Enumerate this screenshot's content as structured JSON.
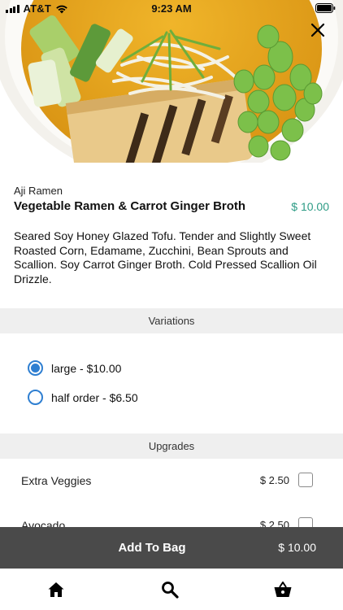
{
  "status_bar": {
    "carrier": "AT&T",
    "time": "9:23 AM",
    "icons": [
      "signal-icon",
      "wifi-icon",
      "battery-icon"
    ]
  },
  "hero": {
    "image": "ramen-bowl-photo",
    "close_icon": "close-icon"
  },
  "item": {
    "restaurant": "Aji Ramen",
    "name": "Vegetable Ramen & Carrot Ginger Broth",
    "price": "$ 10.00",
    "description": "Seared Soy Honey Glazed Tofu. Tender and Slightly Sweet Roasted Corn, Edamame, Zucchini, Bean Sprouts and Scallion. Soy Carrot Ginger Broth.  Cold Pressed Scallion Oil Drizzle."
  },
  "variations": {
    "title": "Variations",
    "options": [
      {
        "label": "large - $10.00",
        "selected": true
      },
      {
        "label": "half order - $6.50",
        "selected": false
      }
    ]
  },
  "upgrades": {
    "title": "Upgrades",
    "items": [
      {
        "name": "Extra Veggies",
        "price": "$ 2.50",
        "checked": false
      },
      {
        "name": "Avocado",
        "price": "$ 2.50",
        "checked": false
      }
    ]
  },
  "add_to_bag": {
    "label": "Add To Bag",
    "price": "$ 10.00"
  },
  "nav": {
    "items": [
      "home-icon",
      "search-icon",
      "basket-icon"
    ]
  },
  "colors": {
    "accent_price": "#2e9c86",
    "radio_blue": "#2f7fd1",
    "section_bg": "#efefef",
    "add_bag_bg": "#4a4a4a"
  }
}
